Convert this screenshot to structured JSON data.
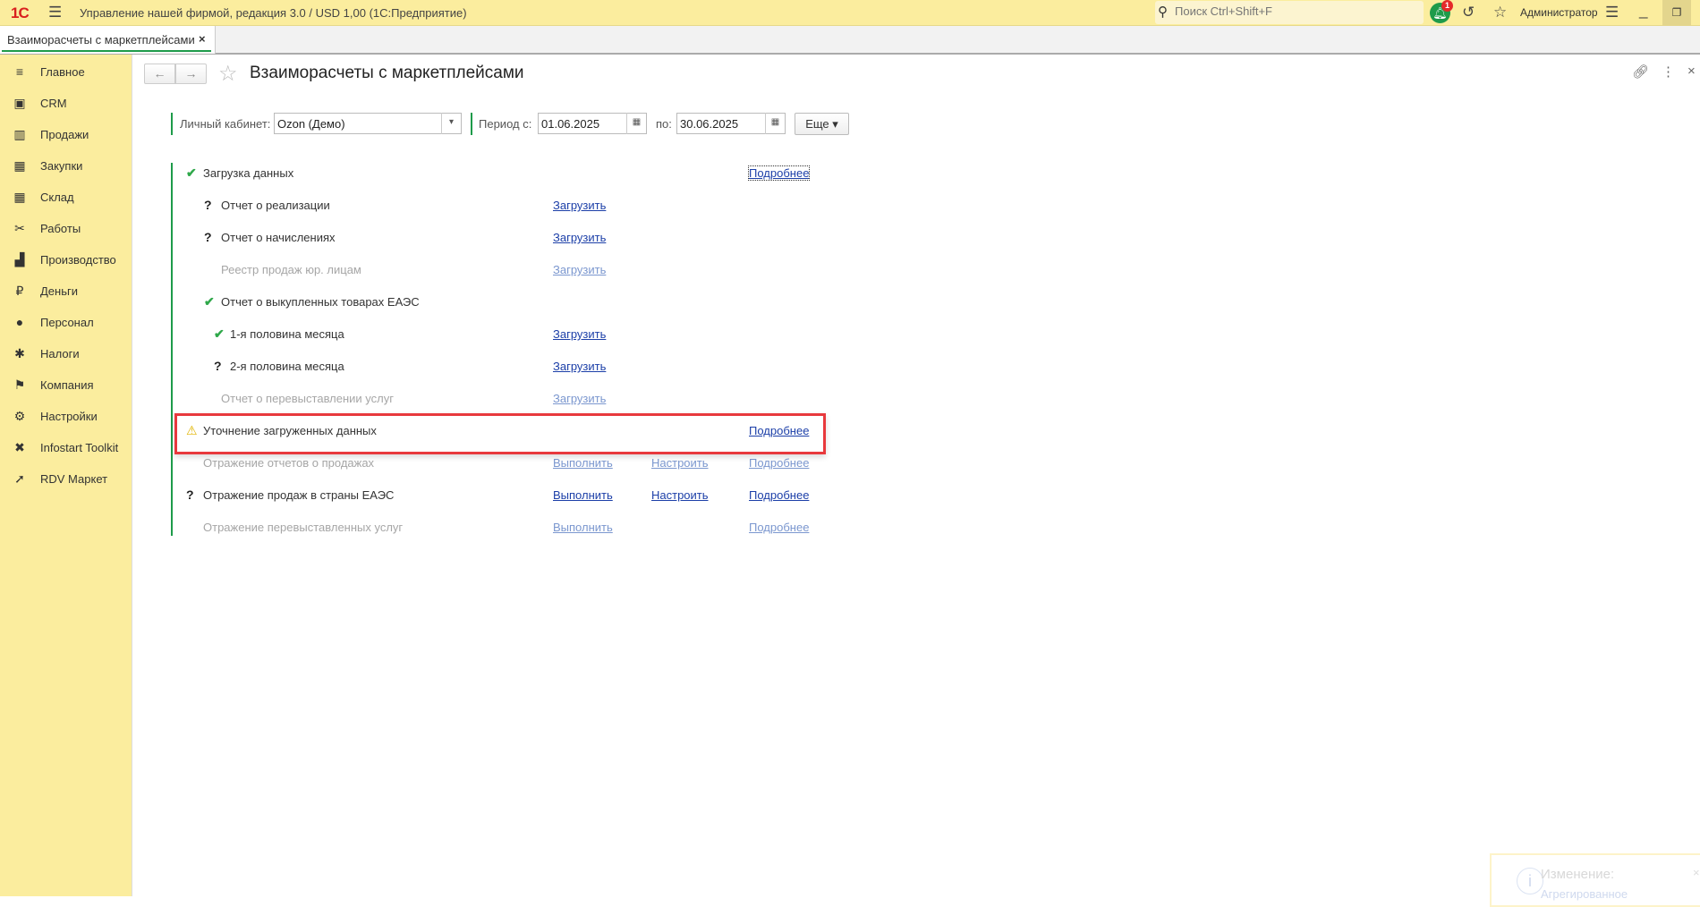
{
  "titlebar": {
    "logo": "1С",
    "app_title": "Управление нашей фирмой, редакция 3.0 / USD 1,00  (1С:Предприятие)",
    "search_placeholder": "Поиск Ctrl+Shift+F",
    "notifications_count": "1",
    "user": "Администратор"
  },
  "tab": {
    "label": "Взаиморасчеты с маркетплейсами",
    "close": "×"
  },
  "sidebar": {
    "items": [
      {
        "label": "Главное",
        "icon": "≡"
      },
      {
        "label": "CRM",
        "icon": "▣"
      },
      {
        "label": "Продажи",
        "icon": "▥"
      },
      {
        "label": "Закупки",
        "icon": "▦"
      },
      {
        "label": "Склад",
        "icon": "▦"
      },
      {
        "label": "Работы",
        "icon": "✂"
      },
      {
        "label": "Производство",
        "icon": "▟"
      },
      {
        "label": "Деньги",
        "icon": "₽"
      },
      {
        "label": "Персонал",
        "icon": "●"
      },
      {
        "label": "Налоги",
        "icon": "✱"
      },
      {
        "label": "Компания",
        "icon": "⚑"
      },
      {
        "label": "Настройки",
        "icon": "⚙"
      },
      {
        "label": "Infostart Toolkit",
        "icon": "✖"
      },
      {
        "label": "RDV Маркет",
        "icon": "➚"
      }
    ]
  },
  "page": {
    "title": "Взаиморасчеты с маркетплейсами"
  },
  "filters": {
    "cabinet_label": "Личный кабинет:",
    "cabinet_value": "Ozon (Демо)",
    "period_from_label": "Период с:",
    "period_from": "01.06.2025",
    "period_to_label": "по:",
    "period_to": "30.06.2025",
    "more": "Еще ▾"
  },
  "rows": [
    {
      "status": "done",
      "text": "Загрузка данных",
      "links": [
        "",
        "",
        "Подробнее"
      ]
    },
    {
      "status": "unknown",
      "text": "Отчет о реализации",
      "links": [
        "Загрузить",
        "",
        ""
      ]
    },
    {
      "status": "unknown",
      "text": "Отчет о начислениях",
      "links": [
        "Загрузить",
        "",
        ""
      ]
    },
    {
      "status": "disabled",
      "text": "Реестр продаж юр. лицам",
      "links": [
        "Загрузить",
        "",
        ""
      ]
    },
    {
      "status": "done",
      "text": "Отчет о выкупленных товарах ЕАЭС",
      "links": [
        "",
        "",
        ""
      ]
    },
    {
      "status": "done",
      "text": "1-я половина месяца",
      "links": [
        "Загрузить",
        "",
        ""
      ]
    },
    {
      "status": "unknown",
      "text": "2-я половина месяца",
      "links": [
        "Загрузить",
        "",
        ""
      ]
    },
    {
      "status": "disabled",
      "text": "Отчет о перевыставлении услуг",
      "links": [
        "Загрузить",
        "",
        ""
      ]
    },
    {
      "status": "warning",
      "text": "Уточнение загруженных данных",
      "links": [
        "",
        "",
        "Подробнее"
      ]
    },
    {
      "status": "disabled",
      "text": "Отражение отчетов о продажах",
      "links": [
        "Выполнить",
        "Настроить",
        "Подробнее"
      ]
    },
    {
      "status": "unknown",
      "text": "Отражение продаж в страны ЕАЭС",
      "links": [
        "Выполнить",
        "Настроить",
        "Подробнее"
      ]
    },
    {
      "status": "disabled",
      "text": "Отражение перевыставленных услуг",
      "links": [
        "Выполнить",
        "",
        "Подробнее"
      ]
    }
  ],
  "toast": {
    "title": "Изменение:",
    "text": "Агрегированное"
  },
  "colors": {
    "accent": "#1e9b4a",
    "panel": "#fbed9e",
    "link": "#1c3fa8",
    "highlight": "#e8393d"
  }
}
